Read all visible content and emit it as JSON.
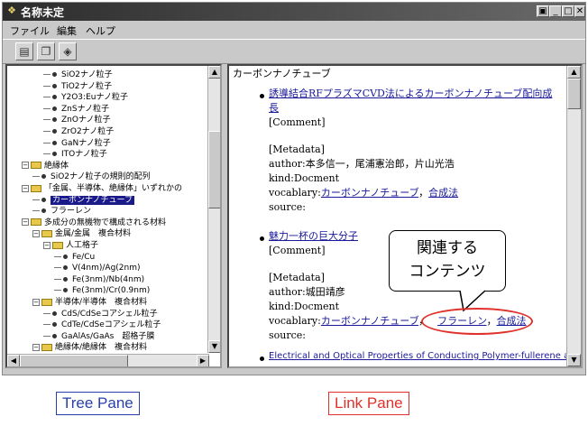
{
  "window": {
    "title": "名称未定",
    "controls": [
      "▣",
      "_",
      "□",
      "✕"
    ]
  },
  "menu": [
    "ファイル",
    "編集",
    "ヘルプ"
  ],
  "toolbar": {
    "icons": [
      "open-folder-icon",
      "copy-icon",
      "refresh-icon"
    ]
  },
  "tree": {
    "items": [
      {
        "label": "SiO2ナノ粒子",
        "type": "leaf"
      },
      {
        "label": "TiO2ナノ粒子",
        "type": "leaf"
      },
      {
        "label": "Y2O3:Euナノ粒子",
        "type": "leaf"
      },
      {
        "label": "ZnSナノ粒子",
        "type": "leaf"
      },
      {
        "label": "ZnOナノ粒子",
        "type": "leaf"
      },
      {
        "label": "ZrO2ナノ粒子",
        "type": "leaf"
      },
      {
        "label": "GaNナノ粒子",
        "type": "leaf"
      },
      {
        "label": "ITOナノ粒子",
        "type": "leaf"
      },
      {
        "label": "絶縁体",
        "type": "folder"
      },
      {
        "label": "SiO2ナノ粒子の規則的配列",
        "type": "leaf"
      },
      {
        "label": "「金属、半導体、絶縁体」いずれかの",
        "type": "folder"
      },
      {
        "label": "カーボンナノチューブ",
        "type": "leaf",
        "selected": true
      },
      {
        "label": "フラーレン",
        "type": "leaf"
      },
      {
        "label": "多成分の無機物で構成される材料",
        "type": "folder"
      },
      {
        "label": "金属/金属　複合材料",
        "type": "folder"
      },
      {
        "label": "人工格子",
        "type": "folder"
      },
      {
        "label": "Fe/Cu",
        "type": "leaf"
      },
      {
        "label": "V(4nm)/Ag(2nm)",
        "type": "leaf"
      },
      {
        "label": "Fe(3nm)/Nb(4nm)",
        "type": "leaf"
      },
      {
        "label": "Fe(3nm)/Cr(0.9nm)",
        "type": "leaf"
      },
      {
        "label": "半導体/半導体　複合材料",
        "type": "folder"
      },
      {
        "label": "CdS/CdSeコアシェル粒子",
        "type": "leaf"
      },
      {
        "label": "CdTe/CdSeコアシェル粒子",
        "type": "leaf"
      },
      {
        "label": "GaAlAs/GaAs　超格子膜",
        "type": "leaf"
      },
      {
        "label": "絶縁体/絶縁体　複合材料",
        "type": "folder"
      }
    ]
  },
  "link": {
    "heading": "カーボンナノチューブ",
    "entry1": {
      "title_line1": "誘導結合RFプラズマCVD法によるカーボンナノチューブ配向成",
      "title_line2": "長",
      "comment": "[Comment]",
      "metadata": "[Metadata]",
      "author": "author:本多信一，尾浦憲治郎，片山光浩",
      "kind": "kind:Docment",
      "vocab_prefix": "vocablary:",
      "vocab1": "カーボンナノチューブ",
      "sep": "，",
      "vocab2": "合成法",
      "source": "source:"
    },
    "entry2": {
      "title": "魅力一杯の巨大分子",
      "comment": "[Comment]",
      "metadata": "[Metadata]",
      "author": "author:城田靖彦",
      "kind": "kind:Docment",
      "vocab_prefix": "vocablary:",
      "vocab1": "カーボンナノチューブ",
      "sep1": "，",
      "vocab2": "フラーレン",
      "sep2": "，",
      "vocab3": "合成法",
      "source": "source:"
    },
    "entry3": {
      "title": "Electrical and Optical Properties of Conducting Polymer-fullerene and"
    }
  },
  "annotations": {
    "callout_line1": "関連する",
    "callout_line2": "コンテンツ",
    "tree_pane_label": "Tree Pane",
    "link_pane_label": "Link Pane",
    "tree_color": "#2a3faa",
    "link_color": "#e0302a"
  }
}
